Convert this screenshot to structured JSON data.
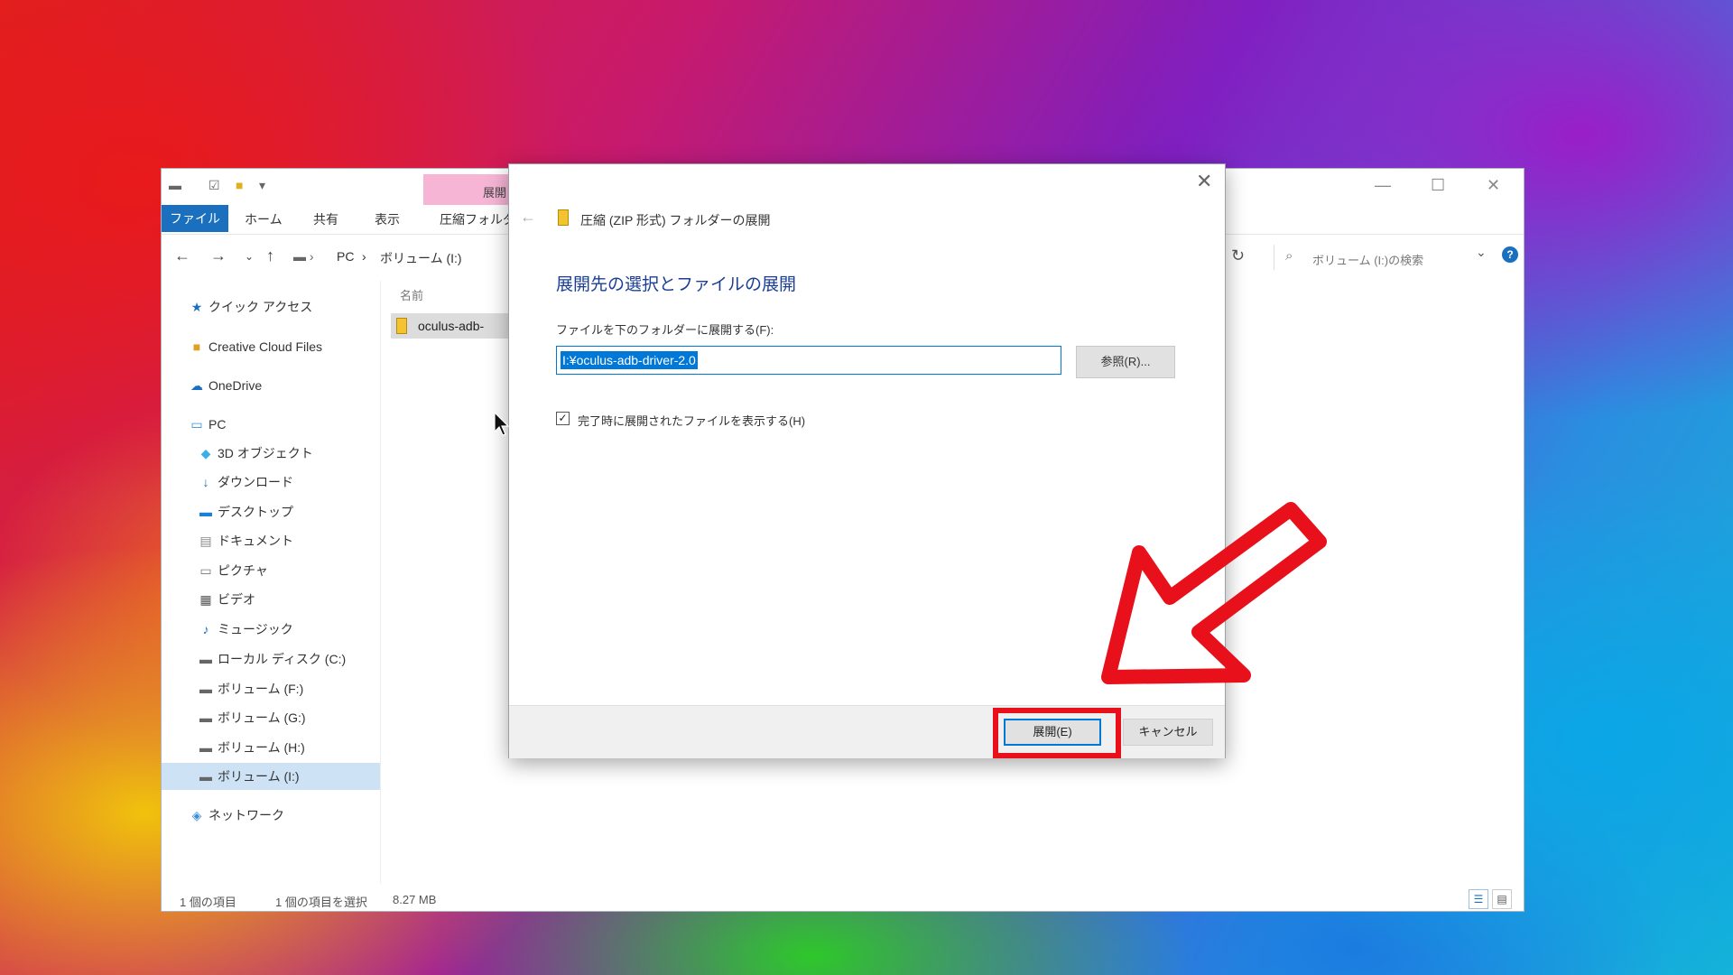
{
  "explorer": {
    "context_tab": "展開",
    "ribbon_tabs": [
      "ファイル",
      "ホーム",
      "共有",
      "表示",
      "圧縮フォルダー"
    ],
    "breadcrumb": [
      "PC",
      "ボリューム (I:)"
    ],
    "search_placeholder": "ボリューム (I:)の検索",
    "column_name": "名前",
    "file_name": "oculus-adb-",
    "sidebar": {
      "quick_access": "クイック アクセス",
      "creative_cloud": "Creative Cloud Files",
      "onedrive": "OneDrive",
      "pc": "PC",
      "items": [
        "3D オブジェクト",
        "ダウンロード",
        "デスクトップ",
        "ドキュメント",
        "ピクチャ",
        "ビデオ",
        "ミュージック",
        "ローカル ディスク (C:)",
        "ボリューム (F:)",
        "ボリューム (G:)",
        "ボリューム (H:)",
        "ボリューム (I:)"
      ],
      "network": "ネットワーク"
    },
    "status": {
      "count": "1 個の項目",
      "selected": "1 個の項目を選択",
      "size": "8.27 MB"
    }
  },
  "dialog": {
    "title": "圧縮 (ZIP 形式) フォルダーの展開",
    "heading": "展開先の選択とファイルの展開",
    "label": "ファイルを下のフォルダーに展開する(F):",
    "path_value": "I:¥oculus-adb-driver-2.0",
    "browse_label": "参照(R)...",
    "checkbox_label": "完了時に展開されたファイルを表示する(H)",
    "checkbox_checked": true,
    "ok_label": "展開(E)",
    "cancel_label": "キャンセル"
  },
  "colors": {
    "accent": "#0078d7",
    "highlight_red": "#e8101a",
    "ribbon_file": "#1a6fbf",
    "context_tab": "#f7b5d6"
  }
}
